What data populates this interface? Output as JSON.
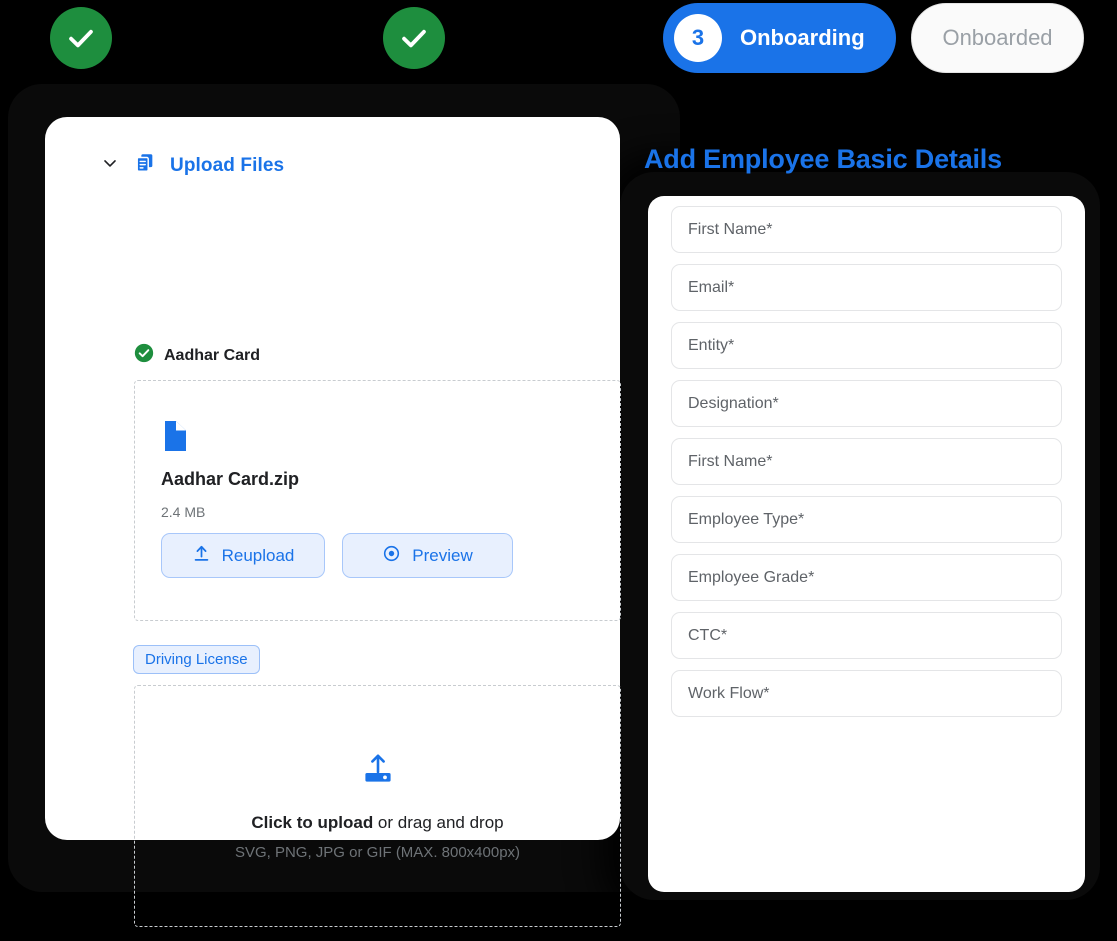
{
  "stepper": {
    "steps": [
      {
        "type": "check",
        "icon": "check-icon",
        "label": ""
      },
      {
        "type": "check",
        "icon": "check-icon",
        "label": ""
      },
      {
        "type": "active",
        "number": "3",
        "label": "Onboarding"
      },
      {
        "type": "inactive",
        "number": "",
        "label": "Onboarded"
      }
    ],
    "active_color": "#1A73E8",
    "complete_color": "#1E8E3E"
  },
  "upload_panel": {
    "header": {
      "label": "Upload Files",
      "chevron_icon": "chevron-down-icon",
      "files_icon": "copy-files-icon",
      "accent": "#1A73E8"
    },
    "documents": [
      {
        "name": "Aadhar Card",
        "status_icon": "check-circle-icon",
        "status_color": "#1E8E3E",
        "file": {
          "icon": "zip-file-icon",
          "name": "Aadhar Card.zip",
          "size": "2.4 MB",
          "actions": [
            {
              "label": "Reupload",
              "icon": "upload-arrow-icon"
            },
            {
              "label": "Preview",
              "icon": "eye-icon"
            }
          ]
        }
      }
    ],
    "pending_document": {
      "chip_label": "Driving License",
      "dropzone": {
        "icon": "upload-tray-icon",
        "primary_strong": "Click to upload",
        "primary_rest": " or drag and drop",
        "secondary": "SVG, PNG, JPG or GIF (MAX. 800x400px)"
      }
    }
  },
  "form_panel": {
    "title": "Add Employee Basic Details",
    "title_color": "#1A73E8",
    "fields": [
      {
        "placeholder": "First Name*",
        "value": ""
      },
      {
        "placeholder": "Email*",
        "value": ""
      },
      {
        "placeholder": "Entity*",
        "value": ""
      },
      {
        "placeholder": "Designation*",
        "value": ""
      },
      {
        "placeholder": "First Name*",
        "value": ""
      },
      {
        "placeholder": "Employee Type*",
        "value": ""
      },
      {
        "placeholder": "Employee Grade*",
        "value": ""
      },
      {
        "placeholder": "CTC*",
        "value": ""
      },
      {
        "placeholder": "Work Flow*",
        "value": ""
      }
    ]
  }
}
